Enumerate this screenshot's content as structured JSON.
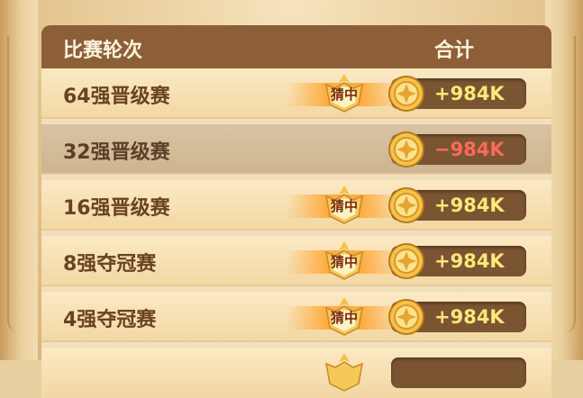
{
  "header": {
    "col_round": "比赛轮次",
    "col_total": "合计"
  },
  "badge_text": "猜中",
  "rows": [
    {
      "label": "64强晋级赛",
      "badge": "猜中",
      "amount": "+984K",
      "status": "win"
    },
    {
      "label": "32强晋级赛",
      "badge": "",
      "amount": "−984K",
      "status": "lose"
    },
    {
      "label": "16强晋级赛",
      "badge": "猜中",
      "amount": "+984K",
      "status": "win"
    },
    {
      "label": "8强夺冠赛",
      "badge": "猜中",
      "amount": "+984K",
      "status": "win"
    },
    {
      "label": "4强夺冠赛",
      "badge": "猜中",
      "amount": "+984K",
      "status": "win"
    }
  ],
  "colors": {
    "header_bg": "#8c5f39",
    "positive": "#ffe87a",
    "negative": "#ff6b5a"
  },
  "icons": {
    "coin": "gold-coin-icon",
    "badge": "crown-badge-icon"
  }
}
